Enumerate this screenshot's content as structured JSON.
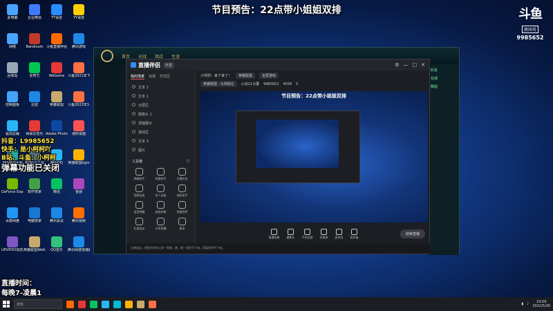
{
  "overlay": {
    "title": "节目预告：22点带小姐姐双排",
    "douyin": "抖音：L9985652",
    "kuaishou": "快手：是小柯柯吖",
    "bilibili": "B站、斗鱼：小柯柯",
    "danmaku_off": "弹幕功能已关闭",
    "live_time_label": "直播时间：",
    "live_time_value": "每晚7-凌晨1"
  },
  "room_logo": {
    "brand": "斗鱼",
    "sub": "房间号",
    "id": "9985652"
  },
  "desktop_icons": [
    {
      "label": "此电脑",
      "color": "#4aa3ff"
    },
    {
      "label": "企业微信",
      "color": "#3e7bff"
    },
    {
      "label": "TT语音",
      "color": "#2b8cff"
    },
    {
      "label": "YY语音",
      "color": "#ffd000"
    },
    {
      "label": "网络",
      "color": "#4aa3ff"
    },
    {
      "label": "Bandicam",
      "color": "#c0392b"
    },
    {
      "label": "斗鱼直播伴侣",
      "color": "#ff6a00"
    },
    {
      "label": "腾讯游戏",
      "color": "#1e88e5"
    },
    {
      "label": "回收站",
      "color": "#9aa7b5"
    },
    {
      "label": "爱奇艺",
      "color": "#00c853"
    },
    {
      "label": "WeGame",
      "color": "#e53935"
    },
    {
      "label": "斗鱼2021年下半年直播",
      "color": "#ff7043"
    },
    {
      "label": "控制面板",
      "color": "#42a5f5"
    },
    {
      "label": "迅雷",
      "color": "#1e88e5"
    },
    {
      "label": "英雄联盟",
      "color": "#c9aa6e"
    },
    {
      "label": "斗鱼2022年1-2月直播",
      "color": "#ff7043"
    },
    {
      "label": "驱动总裁",
      "color": "#29b6f6"
    },
    {
      "label": "网易云音乐",
      "color": "#e53935"
    },
    {
      "label": "Adobe Photosh...",
      "color": "#0d47a1"
    },
    {
      "label": "通秒桌面",
      "color": "#ff5252"
    },
    {
      "label": "360驱动大师",
      "color": "#26a69a"
    },
    {
      "label": "ROKI小工具",
      "color": "#546e7a"
    },
    {
      "label": "腾讯QQ",
      "color": "#29b6f6"
    },
    {
      "label": "英雄联盟bgm",
      "color": "#ffb300"
    },
    {
      "label": "GeForce Experience",
      "color": "#76b900"
    },
    {
      "label": "软件管家",
      "color": "#43a047"
    },
    {
      "label": "微信",
      "color": "#07c160"
    },
    {
      "label": "金融",
      "color": "#ab47bc"
    },
    {
      "label": "百度网盘",
      "color": "#2196f3"
    },
    {
      "label": "电脑管家",
      "color": "#1976d2"
    },
    {
      "label": "腾讯会议",
      "color": "#1e88e5"
    },
    {
      "label": "腾讯视频",
      "color": "#ff6f00"
    },
    {
      "label": "UPUPOO动态桌面",
      "color": "#7e57c2"
    },
    {
      "label": "英雄联盟WeGame版",
      "color": "#c9aa6e"
    },
    {
      "label": "QQ音乐",
      "color": "#31c27c"
    },
    {
      "label": "腾讯网游加速器",
      "color": "#1e88e5"
    }
  ],
  "obs": {
    "brand": "直播伴侣",
    "badge": "开发",
    "tabs": [
      "我的场景",
      "双通",
      "司法区"
    ],
    "sources": [
      "文本 2",
      "文本 1",
      "分层区",
      "摄像头 1",
      "顶端展示",
      "游戏区",
      "文本 3",
      "图片"
    ],
    "tools_title": "工具箱",
    "tools": [
      "弹幕助手",
      "房管助手",
      "主播任务",
      "视频连麦",
      "多人连麦",
      "抽奖助手",
      "语音弹幕",
      "虚拟形象",
      "观看频率",
      "礼物连击",
      "分享直播",
      "更多"
    ],
    "room_title": "小柯柯：来了来了！",
    "category": "英雄联盟",
    "tag_edit": "全屏游戏",
    "info_row2": [
      "英雄联盟 · 大师段位",
      "心动11大厦",
      "9985652",
      "4038",
      "5"
    ],
    "controls": [
      "直播场景",
      "摄像头",
      "手机投屏",
      "多媒体",
      "麦克风",
      "扬声器"
    ],
    "start_label": "结束直播",
    "status": "礼物连击，就是在你的心里一直跑，跑，跑一直停不下来，是真的停不下来。"
  },
  "preview": {
    "title": "节目预告：22点带小姐姐双排"
  },
  "taskbar": {
    "search_placeholder": "搜索",
    "time": "19:09",
    "date": "2022/5/26",
    "apps": [
      "#ff6a00",
      "#e53935",
      "#07c160",
      "#29b6f6",
      "#00bcd4",
      "#ffb300",
      "#c9aa6e",
      "#ff7043"
    ]
  },
  "game": {
    "nav": [
      "首页",
      "对战",
      "商店",
      "生涯"
    ],
    "side": [
      "好友",
      "在线",
      "群组"
    ]
  }
}
